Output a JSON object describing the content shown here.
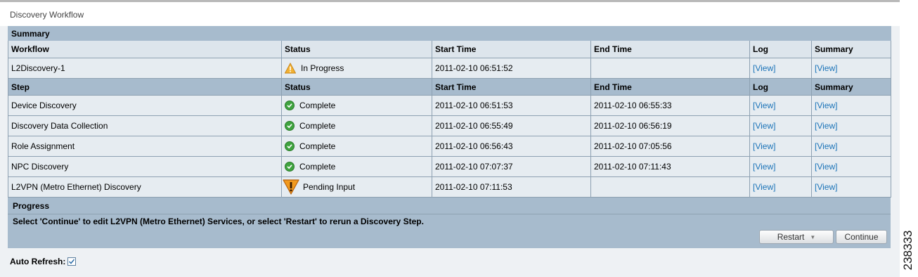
{
  "page_title": "Discovery Workflow",
  "summary_section": {
    "label": "Summary"
  },
  "workflow_header": [
    "Workflow",
    "Status",
    "Start Time",
    "End Time",
    "Log",
    "Summary"
  ],
  "workflow": {
    "name": "L2Discovery-1",
    "status": "In Progress",
    "status_icon": "warning-icon",
    "start": "2011-02-10 06:51:52",
    "end": "",
    "log": "[View]",
    "summary": "[View]"
  },
  "step_header": [
    "Step",
    "Status",
    "Start Time",
    "End Time",
    "Log",
    "Summary"
  ],
  "steps": [
    {
      "name": "Device Discovery",
      "status": "Complete",
      "icon": "check-circle-icon",
      "start": "2011-02-10 06:51:53",
      "end": "2011-02-10 06:55:33",
      "log": "[View]",
      "summary": "[View]"
    },
    {
      "name": "Discovery Data Collection",
      "status": "Complete",
      "icon": "check-circle-icon",
      "start": "2011-02-10 06:55:49",
      "end": "2011-02-10 06:56:19",
      "log": "[View]",
      "summary": "[View]"
    },
    {
      "name": "Role Assignment",
      "status": "Complete",
      "icon": "check-circle-icon",
      "start": "2011-02-10 06:56:43",
      "end": "2011-02-10 07:05:56",
      "log": "[View]",
      "summary": "[View]"
    },
    {
      "name": "NPC Discovery",
      "status": "Complete",
      "icon": "check-circle-icon",
      "start": "2011-02-10 07:07:37",
      "end": "2011-02-10 07:11:43",
      "log": "[View]",
      "summary": "[View]"
    },
    {
      "name": "L2VPN (Metro Ethernet) Discovery",
      "status": "Pending Input",
      "icon": "alert-icon",
      "start": "2011-02-10 07:11:53",
      "end": "",
      "log": "[View]",
      "summary": "[View]"
    }
  ],
  "progress": {
    "label": "Progress",
    "message": "Select 'Continue' to edit L2VPN (Metro Ethernet) Services, or select 'Restart' to rerun a Discovery Step.",
    "restart_label": "Restart",
    "continue_label": "Continue"
  },
  "auto_refresh": {
    "label": "Auto Refresh:",
    "checked": true
  },
  "figure_id": "238333",
  "colors": {
    "section_bg": "#a7bbcd",
    "row_bg": "#e6ecf1",
    "link": "#1a73b8",
    "complete": "#3fa33f",
    "warning": "#f0a020"
  }
}
